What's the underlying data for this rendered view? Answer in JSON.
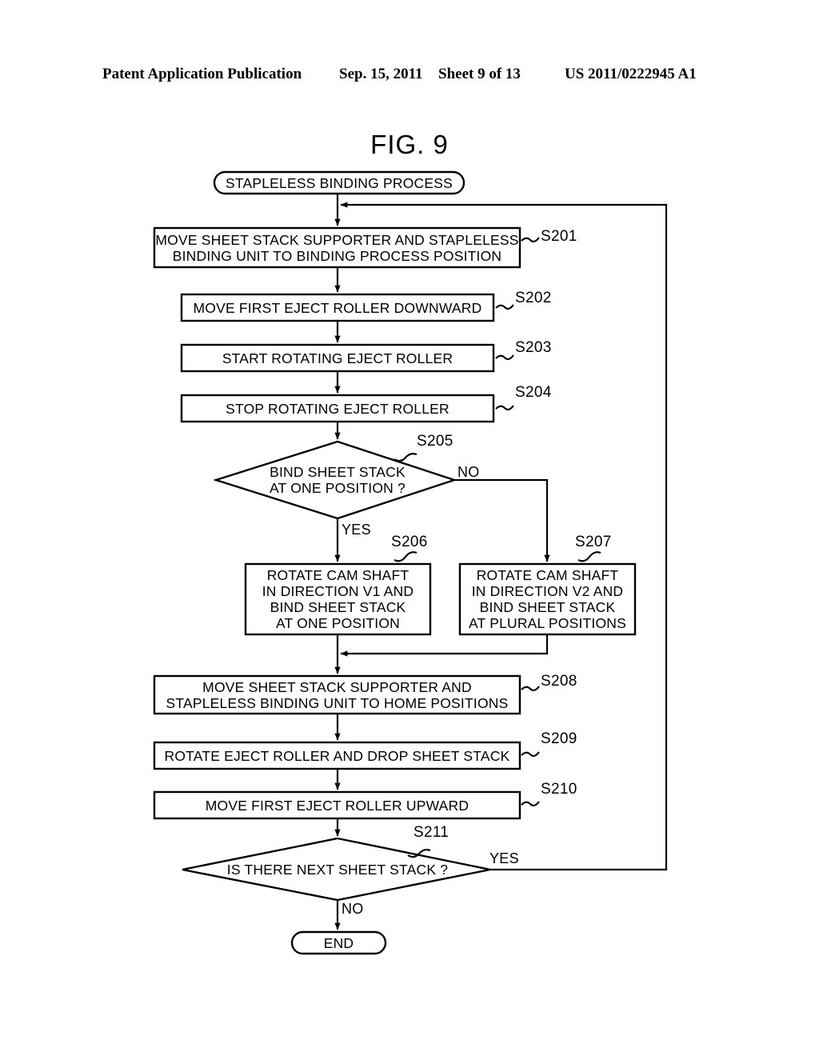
{
  "header": {
    "publication": "Patent Application Publication",
    "date": "Sep. 15, 2011",
    "sheet": "Sheet 9 of 13",
    "number": "US 2011/0222945 A1"
  },
  "figure": {
    "title": "FIG. 9"
  },
  "flowchart": {
    "start": {
      "label": "STAPLELESS BINDING PROCESS"
    },
    "end": {
      "label": "END"
    },
    "steps": [
      {
        "id": "S201",
        "text": "MOVE SHEET STACK SUPPORTER AND STAPLELESS\nBINDING UNIT TO BINDING PROCESS POSITION"
      },
      {
        "id": "S202",
        "text": "MOVE FIRST EJECT ROLLER DOWNWARD"
      },
      {
        "id": "S203",
        "text": "START ROTATING EJECT ROLLER"
      },
      {
        "id": "S204",
        "text": "STOP ROTATING EJECT ROLLER"
      },
      {
        "id": "S205",
        "text": "BIND SHEET STACK\nAT ONE POSITION ?"
      },
      {
        "id": "S206",
        "text": "ROTATE CAM SHAFT\nIN DIRECTION V1 AND\nBIND SHEET STACK\nAT ONE POSITION"
      },
      {
        "id": "S207",
        "text": "ROTATE CAM SHAFT\nIN DIRECTION V2 AND\nBIND SHEET STACK\nAT PLURAL POSITIONS"
      },
      {
        "id": "S208",
        "text": "MOVE SHEET STACK SUPPORTER AND\nSTAPLELESS BINDING UNIT TO HOME POSITIONS"
      },
      {
        "id": "S209",
        "text": "ROTATE EJECT ROLLER AND DROP SHEET STACK"
      },
      {
        "id": "S210",
        "text": "MOVE FIRST EJECT ROLLER UPWARD"
      },
      {
        "id": "S211",
        "text": "IS THERE NEXT SHEET STACK ?"
      }
    ],
    "branch_labels": {
      "s205_no": "NO",
      "s205_yes": "YES",
      "s211_yes": "YES",
      "s211_no": "NO"
    }
  },
  "colors": {
    "ink": "#000000",
    "paper": "#ffffff"
  }
}
